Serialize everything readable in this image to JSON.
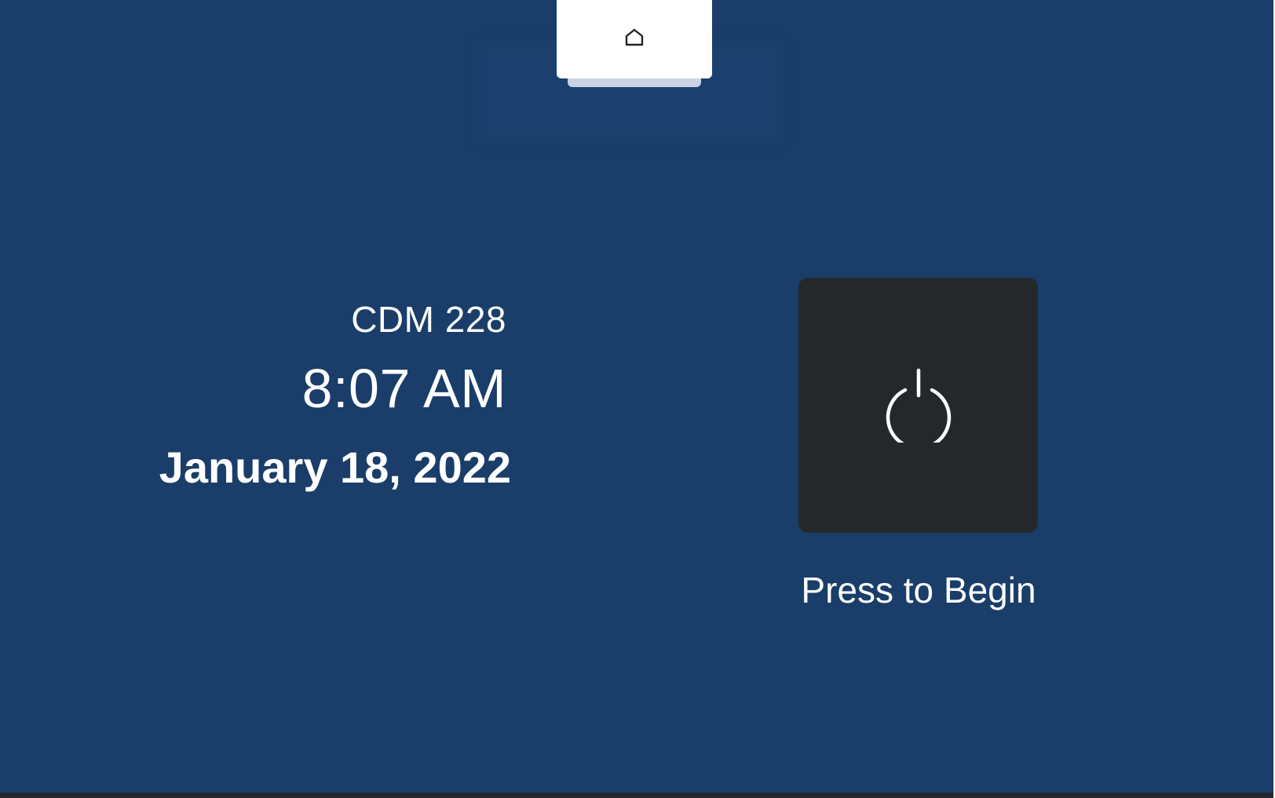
{
  "header": {
    "home_icon": "home-icon"
  },
  "room_info": {
    "room_name": "CDM 228",
    "time": "8:07 AM",
    "date": "January 18, 2022"
  },
  "power": {
    "icon": "power-icon",
    "label": "Press to Begin"
  },
  "colors": {
    "background": "#1a3d69",
    "button": "#25282b",
    "text": "#ffffff"
  }
}
